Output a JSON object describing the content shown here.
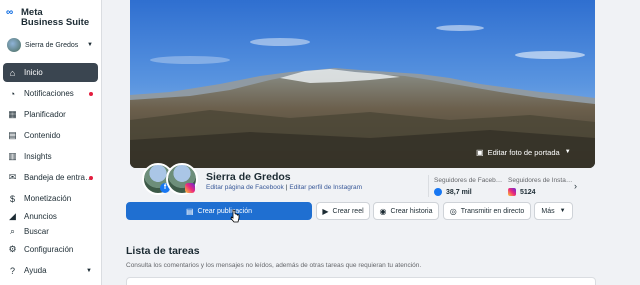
{
  "brand": {
    "line1": "Meta",
    "line2": "Business Suite",
    "logo_glyph": "∞"
  },
  "page_selector": {
    "name": "Sierra de Gredos"
  },
  "nav": [
    {
      "label": "Inicio",
      "icon": "home-icon",
      "glyph": "⌂",
      "active": true
    },
    {
      "label": "Notificaciones",
      "icon": "bell-icon",
      "glyph": "🔔",
      "dot": true
    },
    {
      "label": "Planificador",
      "icon": "calendar-icon",
      "glyph": "▦"
    },
    {
      "label": "Contenido",
      "icon": "content-icon",
      "glyph": "▤"
    },
    {
      "label": "Insights",
      "icon": "chart-icon",
      "glyph": "▥"
    },
    {
      "label": "Bandeja de entra…",
      "icon": "inbox-icon",
      "glyph": "✉",
      "dot": true
    },
    {
      "label": "Monetización",
      "icon": "dollar-icon",
      "glyph": "$"
    },
    {
      "label": "Anuncios",
      "icon": "megaphone-icon",
      "glyph": "◢"
    },
    {
      "label": "Buscar",
      "icon": "search-icon",
      "glyph": "⌕"
    },
    {
      "label": "Configuración",
      "icon": "gear-icon",
      "glyph": "⚙"
    },
    {
      "label": "Ayuda",
      "icon": "help-icon",
      "glyph": "?",
      "dropdown": true
    }
  ],
  "cover": {
    "edit_label": "Editar foto de portada"
  },
  "profile": {
    "name": "Sierra de Gredos",
    "fb_link": "Editar página de Facebook",
    "separator": "|",
    "ig_link": "Editar perfil de Instagram"
  },
  "stats": [
    {
      "label": "Seguidores de Faceb…",
      "value": "38,7 mil",
      "icon": "facebook-icon"
    },
    {
      "label": "Seguidores de Insta…",
      "value": "5124",
      "icon": "instagram-icon"
    }
  ],
  "actions": {
    "create_post": "Crear publicación",
    "create_reel": "Crear reel",
    "create_story": "Crear historia",
    "go_live": "Transmitir en directo",
    "more": "Más"
  },
  "tasks": {
    "title": "Lista de tareas",
    "subtitle": "Consulta los comentarios y los mensajes no leídos, además de otras tareas que requieran tu atención."
  },
  "colors": {
    "primary": "#1f6fd1",
    "active_nav": "#3a4550",
    "notification": "#e41e3f"
  }
}
